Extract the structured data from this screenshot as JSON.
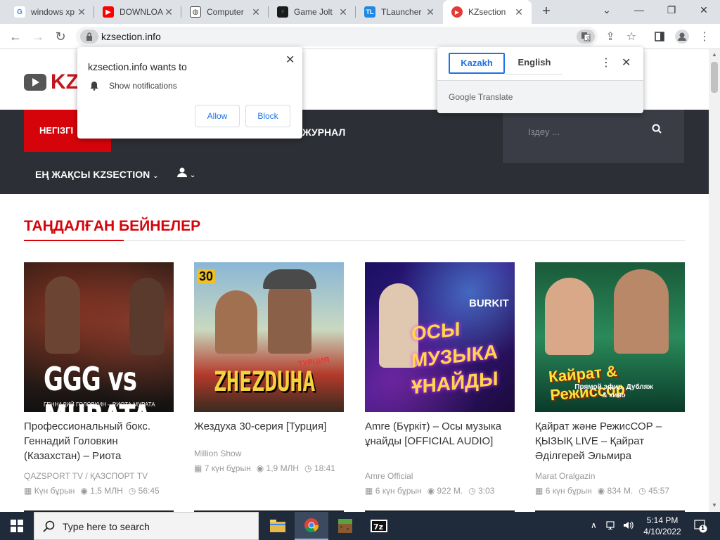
{
  "browser": {
    "tabs": [
      {
        "title": "windows xp",
        "icon": "google-g",
        "color": "#4285f4",
        "glyph": "G",
        "active": false
      },
      {
        "title": "DOWNLOAD",
        "icon": "youtube",
        "color": "#ff0000",
        "glyph": "▶",
        "active": false
      },
      {
        "title": "Computer",
        "icon": "computer",
        "color": "#555555",
        "glyph": "◍",
        "active": false
      },
      {
        "title": "Game Jolt",
        "icon": "game-jolt",
        "color": "#1a1a1a",
        "glyph": "⚡",
        "active": false
      },
      {
        "title": "TLauncher",
        "icon": "tlauncher",
        "color": "#1e88e5",
        "glyph": "TL",
        "active": false
      },
      {
        "title": "KZsection",
        "icon": "kzsection",
        "color": "#e53935",
        "glyph": "▶",
        "active": true
      }
    ],
    "url": "kzsection.info"
  },
  "permission_popup": {
    "title": "kzsection.info wants to",
    "item": "Show notifications",
    "allow": "Allow",
    "block": "Block"
  },
  "translate_popup": {
    "lang_source": "Kazakh",
    "lang_target": "English",
    "footer": "Google Translate"
  },
  "site": {
    "logo_text": "KZ",
    "nav": {
      "home": "НЕГІЗГІ",
      "journal": "ЖУРНАЛ",
      "best": "ЕҢ ЖАҚСЫ KZSECTION",
      "search_placeholder": "Іздеу ..."
    },
    "section_title": "ТАҢДАЛҒАН БЕЙНЕЛЕР",
    "cards": [
      {
        "title": "Профессиональный бокс. Геннадий Головкин (Казахстан) – Риота",
        "author": "QAZSPORT TV / ҚАЗСПОРТ TV",
        "date": "Күн бұрын",
        "views": "1,5 МЛН",
        "duration": "56:45",
        "thumb_text": "GGG vs MURATA",
        "thumb_sub": "ГЕННАДИЙ ГОЛОВКИН – РИОТА МУРАТА"
      },
      {
        "title": "Жездуха 30-серия [Турция]",
        "author": "Million Show",
        "date": "7 күн бұрын",
        "views": "1,9 МЛН",
        "duration": "18:41",
        "thumb_text": "ZHEZDUHA",
        "thumb_badge": "30",
        "thumb_sub": "ТУРЦИЯ"
      },
      {
        "title": "Amre (Бүркіт) – Осы музыка ұнайды [OFFICIAL AUDIO]",
        "author": "Amre Official",
        "date": "6 күн бұрын",
        "views": "922 М.",
        "duration": "3:03",
        "thumb_text": "ОСЫ МУЗЫКА ҰНАЙДЫ",
        "thumb_badge": "BURKIT"
      },
      {
        "title": "Қайрат және РежисСОР – ҚЫЗЫҚ LIVE – Қайрат Әділгерей Эльмира",
        "author": "Marat Oralgazin",
        "date": "6 күн бұрын",
        "views": "834 М.",
        "duration": "45:57",
        "thumb_text": "Кайрат & Режиссор",
        "thumb_sub": "Прямой эфир, Дубляж & кино"
      }
    ]
  },
  "taskbar": {
    "search_placeholder": "Type here to search",
    "time": "5:14 PM",
    "date": "4/10/2022",
    "notifications": "1"
  }
}
